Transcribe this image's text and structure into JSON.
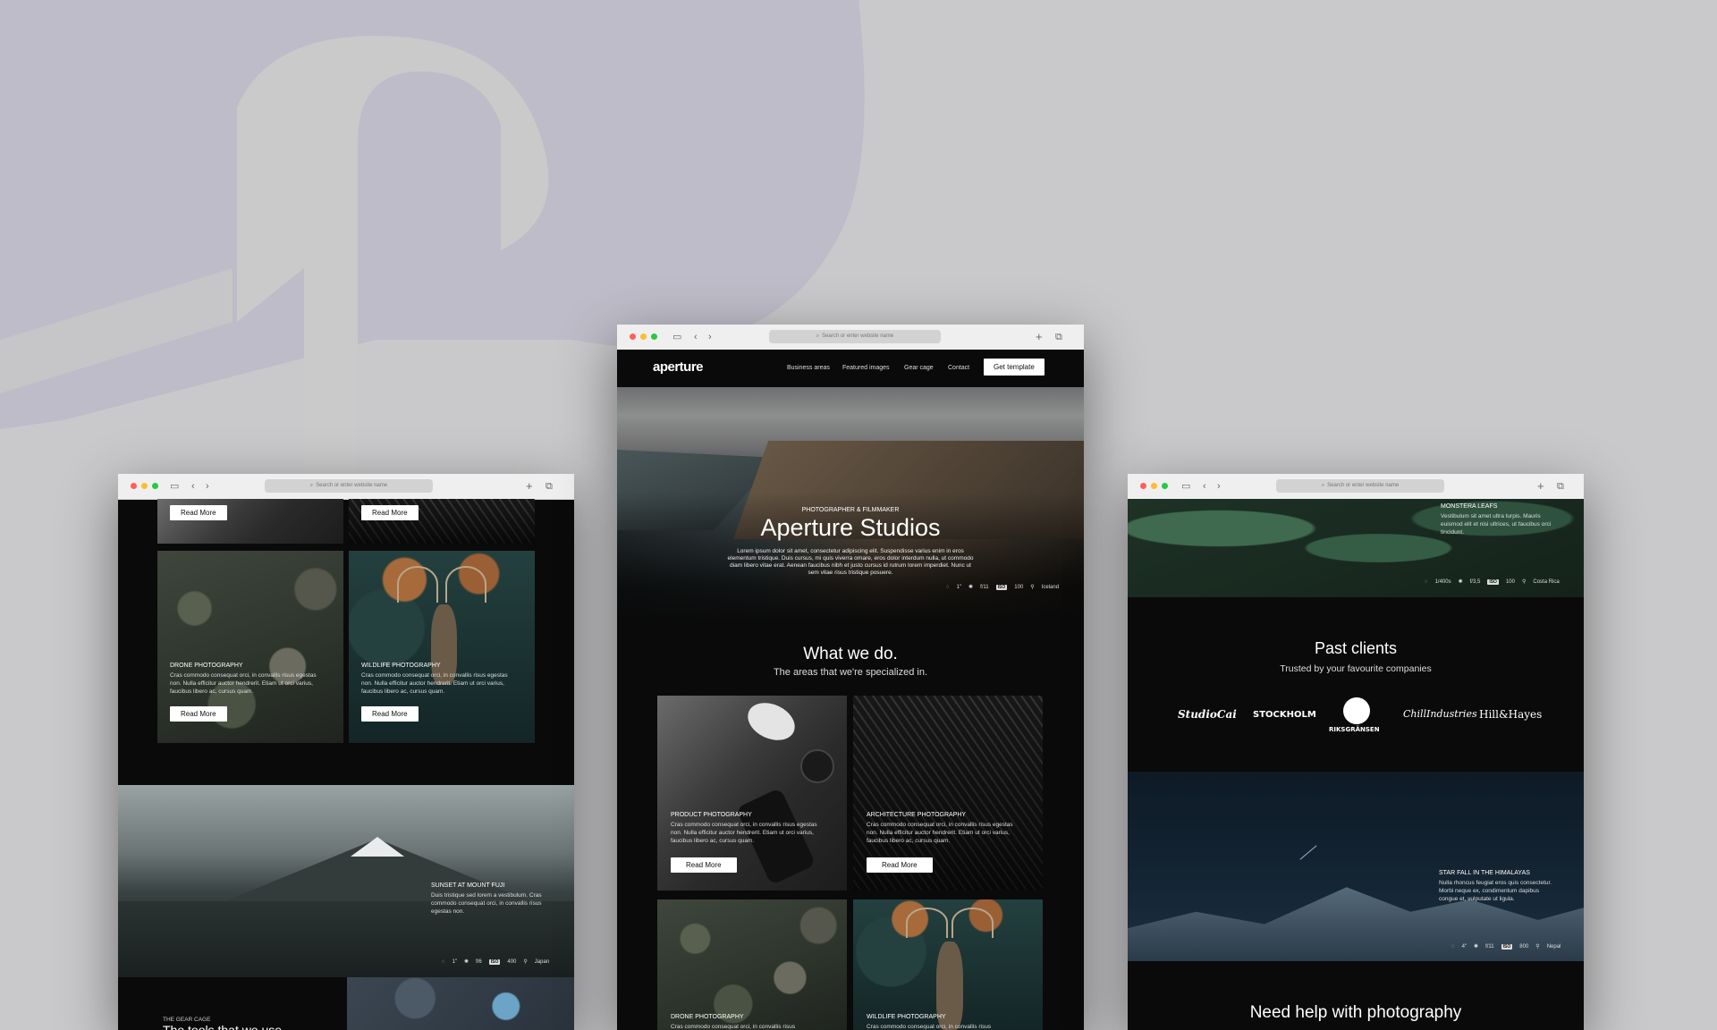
{
  "colors": {
    "background": "#c9c9cb",
    "logo_mark": "#bfbec9",
    "page_dark": "#0a0a0a",
    "dot_red": "#ff5f57",
    "dot_yellow": "#febc2e",
    "dot_green": "#28c840"
  },
  "browser": {
    "address_placeholder": "Search or enter website name"
  },
  "left": {
    "cards_top": [
      {
        "button": "Read More"
      },
      {
        "button": "Read More"
      }
    ],
    "cards": [
      {
        "title": "DRONE PHOTOGRAPHY",
        "text": "Cras commodo consequat orci, in convallis risus egestas non. Nulla efficitur auctor hendrerit. Etiam ut orci varius, faucibus libero ac, cursus quam.",
        "button": "Read More"
      },
      {
        "title": "WILDLIFE PHOTOGRAPHY",
        "text": "Cras commodo consequat orci, in convallis risus egestas non. Nulla efficitur auctor hendrerit. Etiam ut orci varius, faucibus libero ac, cursus quam.",
        "button": "Read More"
      }
    ],
    "feature": {
      "title": "SUNSET AT MOUNT FUJI",
      "text": "Duis tristique sed lorem a vestibulum. Cras commodo consequat orci, in convallis risus egestas non.",
      "meta": {
        "shutter": "1\"",
        "aperture": "f/6",
        "iso_label": "ISO",
        "iso": "400",
        "location": "Japan"
      }
    },
    "gear": {
      "kicker": "THE GEAR CAGE",
      "title": "The tools that we use"
    }
  },
  "center": {
    "nav": {
      "logo": "aperture",
      "links": [
        "Business areas",
        "Featured images",
        "Gear cage",
        "Contact"
      ],
      "cta": "Get template"
    },
    "hero": {
      "kicker": "PHOTOGRAPHER & FILMMAKER",
      "title": "Aperture Studios",
      "text": "Lorem ipsum dolor sit amet, consectetur adipiscing elit. Suspendisse varius enim in eros elementum tristique. Duis cursus, mi quis viverra ornare, eros dolor interdum nulla, ut commodo diam libero vitae erat. Aenean faucibus nibh et justo cursus id rutrum lorem imperdiet. Nunc ut sem vitae risus tristique posuere.",
      "meta": {
        "shutter": "1\"",
        "aperture": "f/11",
        "iso_label": "ISO",
        "iso": "100",
        "location": "Iceland"
      }
    },
    "section": {
      "title": "What we do.",
      "subtitle": "The areas that we're specialized in."
    },
    "cards": [
      {
        "title": "PRODUCT PHOTOGRAPHY",
        "text": "Cras commodo consequat orci, in convallis risus egestas non. Nulla efficitur auctor hendrerit. Etiam ut orci varius, faucibus libero ac, cursus quam.",
        "button": "Read More"
      },
      {
        "title": "ARCHITECTURE PHOTOGRAPHY",
        "text": "Cras commodo consequat orci, in convallis risus egestas non. Nulla efficitur auctor hendrerit. Etiam ut orci varius, faucibus libero ac, cursus quam.",
        "button": "Read More"
      },
      {
        "title": "DRONE PHOTOGRAPHY",
        "text": "Cras commodo consequat orci, in convallis risus"
      },
      {
        "title": "WILDLIFE PHOTOGRAPHY",
        "text": "Cras commodo consequat orci, in convallis risus"
      }
    ]
  },
  "right": {
    "top": {
      "title": "MONSTERA LEAFS",
      "text": "Vestibulum sit amet ultra turpis. Mauris euismod elit et nisi ultrices, ut faucibus orci tincidunt.",
      "meta": {
        "shutter": "1/400s",
        "aperture": "f/3,5",
        "iso_label": "ISO",
        "iso": "100",
        "location": "Costa Rica"
      }
    },
    "clients": {
      "title": "Past clients",
      "subtitle": "Trusted by your favourite companies",
      "logos": [
        "StudioCai",
        "STOCKHOLM",
        "RIKSGRÄNSEN",
        "ChillIndustries",
        "Hill&Hayes"
      ]
    },
    "feature": {
      "title": "STAR FALL IN THE HIMALAYAS",
      "text": "Nulla rhoncus feugiat eros quis consectetur. Morbi neque ex, condimentum dapibus congue et, vulputate ut ligula.",
      "meta": {
        "shutter": "4\"",
        "aperture": "f/11",
        "iso_label": "ISO",
        "iso": "800",
        "location": "Nepal"
      }
    },
    "cta": {
      "title": "Need help with photography"
    }
  }
}
